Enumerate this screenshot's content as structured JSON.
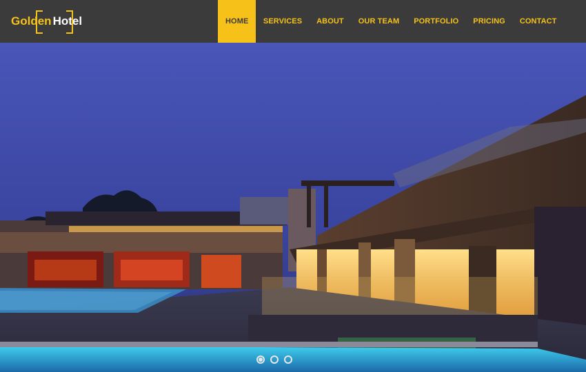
{
  "brand": {
    "word1": "Golden",
    "word2": "Hotel"
  },
  "nav": {
    "items": [
      {
        "label": "HOME",
        "active": true
      },
      {
        "label": "SERVICES"
      },
      {
        "label": "ABOUT"
      },
      {
        "label": "OUR TEAM"
      },
      {
        "label": "PORTFOLIO"
      },
      {
        "label": "PRICING"
      },
      {
        "label": "CONTACT"
      }
    ]
  },
  "slider": {
    "slide_count": 3,
    "active_index": 0
  },
  "colors": {
    "accent": "#f6c21a",
    "header_bg": "#3b3b3b"
  }
}
